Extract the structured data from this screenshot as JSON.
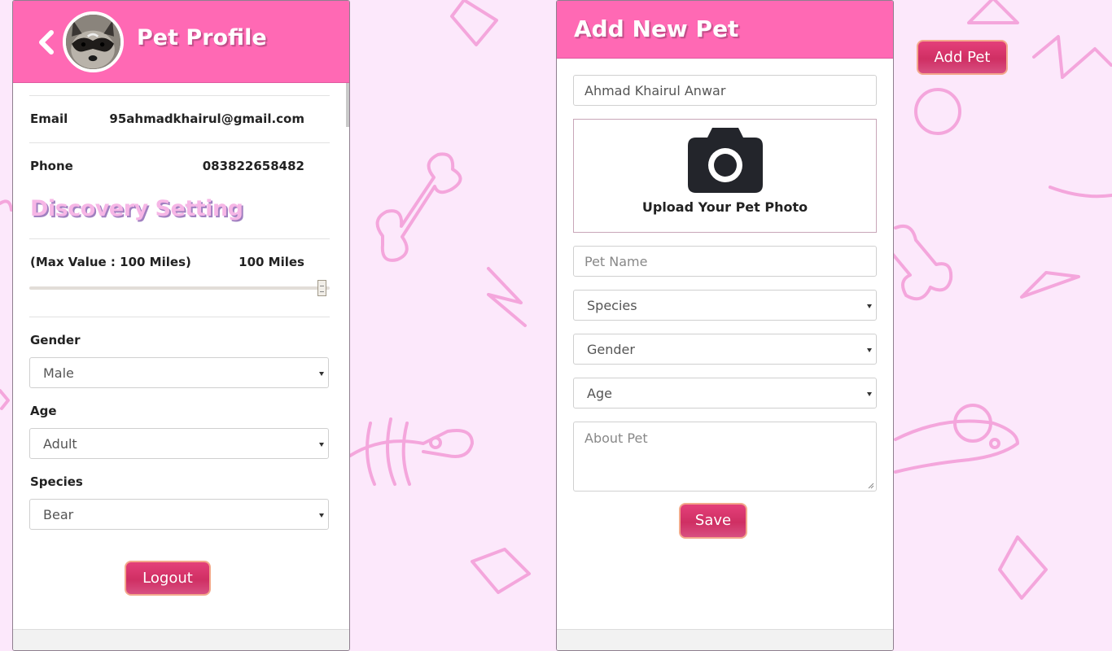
{
  "colors": {
    "header": "#ff69b4",
    "background": "#fce8fb",
    "button": "#cf2f63",
    "button_border": "#f3a98c",
    "doodle": "#f4a6dc",
    "discovery_text": "#f6b6e6"
  },
  "profile": {
    "title": "Pet Profile",
    "back_icon": "chevron-left-icon",
    "avatar": "raccoon-avatar",
    "email_label": "Email",
    "email_value": "95ahmadkhairul@gmail.com",
    "phone_label": "Phone",
    "phone_value": "083822658482",
    "discovery_title": "Discovery Setting",
    "distance_label": "(Max Value : 100 Miles)",
    "distance_value": "100 Miles",
    "distance_slider_fraction": 1.0,
    "gender_label": "Gender",
    "gender_value": "Male",
    "age_label": "Age",
    "age_value": "Adult",
    "species_label": "Species",
    "species_value": "Bear",
    "logout_label": "Logout"
  },
  "add_pet": {
    "title": "Add New Pet",
    "owner_value": "Ahmad Khairul Anwar",
    "upload_icon": "camera-icon",
    "upload_label": "Upload Your Pet Photo",
    "name_placeholder": "Pet Name",
    "species_placeholder": "Species",
    "gender_placeholder": "Gender",
    "age_placeholder": "Age",
    "about_placeholder": "About Pet",
    "save_label": "Save"
  },
  "floating": {
    "add_pet_label": "Add Pet"
  }
}
